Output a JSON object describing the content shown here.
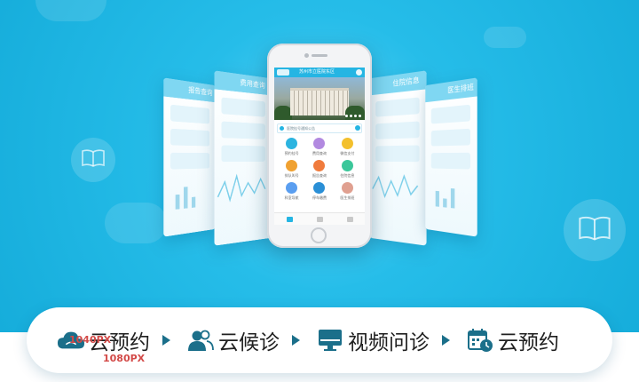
{
  "colors": {
    "background": "#1fb7e7",
    "accent": "#25b5e3",
    "icon_dark": "#1b6f8a",
    "overlay_text": "#d34a48"
  },
  "phone": {
    "header_title": "苏州市立医院东区",
    "notice_text": "医院挂号通知公告",
    "grid_items": [
      {
        "label": "预约挂号",
        "color": "#2cb4e0",
        "icon": "calendar-icon"
      },
      {
        "label": "费用查询",
        "color": "#b289e0",
        "icon": "bill-icon"
      },
      {
        "label": "微信支付",
        "color": "#f3c02d",
        "icon": "wallet-icon"
      },
      {
        "label": "排队叫号",
        "color": "#f0a131",
        "icon": "queue-icon"
      },
      {
        "label": "报告查询",
        "color": "#f07b3c",
        "icon": "report-icon"
      },
      {
        "label": "住院信息",
        "color": "#3bc79a",
        "icon": "bed-icon"
      },
      {
        "label": "科室导航",
        "color": "#5a9ef0",
        "icon": "nav-icon"
      },
      {
        "label": "停车缴费",
        "color": "#2a8fd6",
        "icon": "car-icon"
      },
      {
        "label": "医生排班",
        "color": "#e0a090",
        "icon": "doctor-icon"
      }
    ]
  },
  "cards": {
    "left_1_title": "报告查询",
    "left_2_title": "费用查询",
    "right_1_title": "住院信息",
    "right_2_title": "医生排班"
  },
  "features": [
    {
      "label": "云预约",
      "icon": "cloud-icon"
    },
    {
      "label": "云候诊",
      "icon": "users-icon"
    },
    {
      "label": "视频问诊",
      "icon": "monitor-icon"
    },
    {
      "label": "云预约",
      "icon": "calendar-clock-icon"
    }
  ],
  "overlay": {
    "width_label": "1040PX",
    "height_label": "1080PX"
  }
}
